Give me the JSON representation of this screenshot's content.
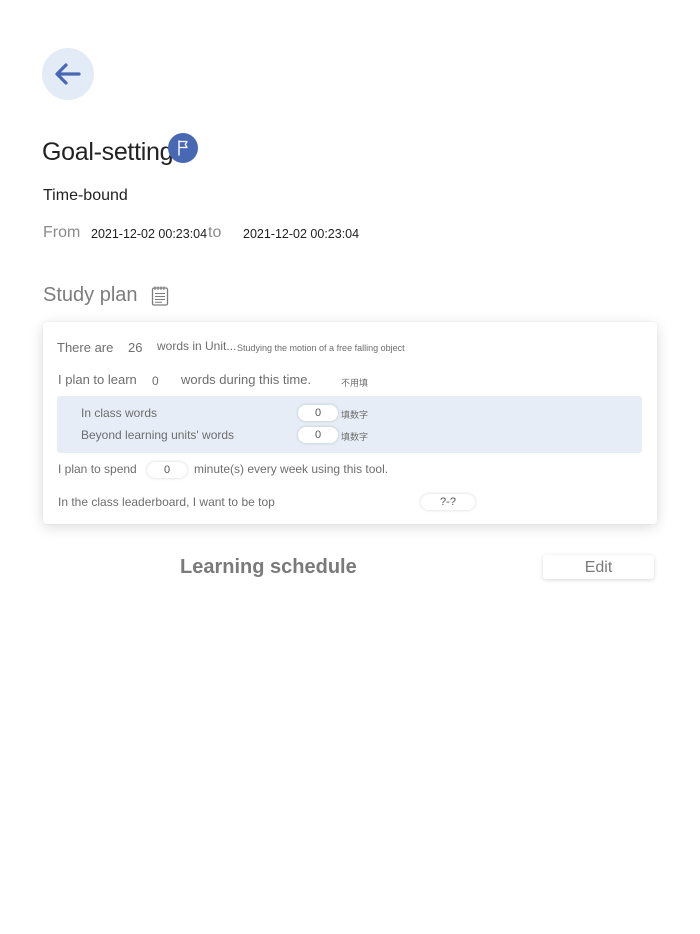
{
  "header": {
    "back_icon": "arrow-left-icon",
    "title": "Goal-setting",
    "title_icon": "flag-icon",
    "subtitle": "Time-bound"
  },
  "timerange": {
    "from_label": "From",
    "from_value": "2021-12-02 00:23:04",
    "to_label": "to",
    "to_value": "2021-12-02 00:23:04"
  },
  "study_plan": {
    "title": "Study plan",
    "icon": "notepad-icon",
    "there_are": "There are",
    "word_count": "26",
    "words_in_unit": "words in Unit...",
    "unit_name": "Studying the motion of a free falling object",
    "plan_to_learn": "I plan to learn",
    "plan_value": "0",
    "words_during": "words during this time.",
    "no_fill_note": "不用填",
    "in_class_label": "In class words",
    "in_class_value": "0",
    "in_class_hint": "填数字",
    "beyond_label": "Beyond learning units' words",
    "beyond_value": "0",
    "beyond_hint": "填数字",
    "plan_to_spend": "I plan to spend",
    "spend_value": "0",
    "minutes_text": "minute(s) every week using this tool.",
    "leaderboard_text": "In the class leaderboard, I want to be top",
    "leaderboard_value": "?-?"
  },
  "schedule": {
    "title": "Learning schedule",
    "edit_label": "Edit"
  },
  "colors": {
    "accent": "#4868b4",
    "back_button_bg": "#e3ebf6",
    "highlight_bg": "#e6edf7"
  }
}
